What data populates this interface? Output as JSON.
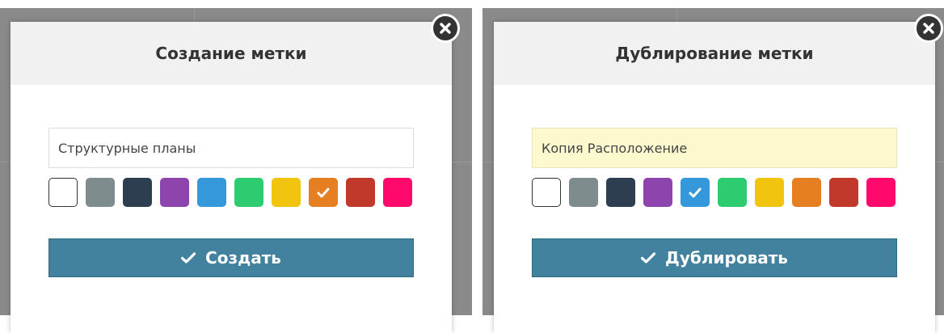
{
  "colors": {
    "palette": [
      "#ffffff",
      "#7f8c8d",
      "#2c3e50",
      "#8e44ad",
      "#3498db",
      "#2ecc71",
      "#f1c40f",
      "#e67e22",
      "#c0392b",
      "#ff0a6c"
    ]
  },
  "create_dialog": {
    "title": "Создание метки",
    "name_value": "Структурные планы",
    "selected_color_index": 7,
    "submit_label": "Создать",
    "submit_icon": "check-icon",
    "close_icon": "close-icon"
  },
  "duplicate_dialog": {
    "title": "Дублирование метки",
    "name_value": "Копия Расположение",
    "selected_color_index": 4,
    "submit_label": "Дублировать",
    "submit_icon": "check-icon",
    "close_icon": "close-icon"
  }
}
